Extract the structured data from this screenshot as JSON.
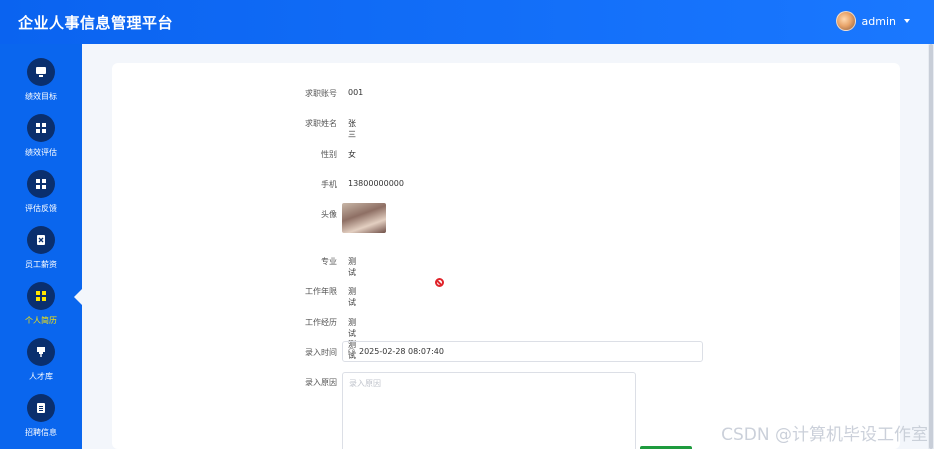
{
  "app": {
    "title": "企业人事信息管理平台"
  },
  "user": {
    "name": "admin"
  },
  "sidebar": {
    "items": [
      {
        "label": "绩效目标",
        "icon": "monitor-icon",
        "active": false
      },
      {
        "label": "绩效评估",
        "icon": "grid-icon",
        "active": false
      },
      {
        "label": "评估反馈",
        "icon": "grid-icon",
        "active": false
      },
      {
        "label": "员工薪资",
        "icon": "clipboard-x-icon",
        "active": false
      },
      {
        "label": "个人简历",
        "icon": "grid-icon",
        "active": true
      },
      {
        "label": "人才库",
        "icon": "pin-icon",
        "active": false
      },
      {
        "label": "招聘信息",
        "icon": "clipboard-icon",
        "active": false
      }
    ]
  },
  "form": {
    "job_id": {
      "label": "求职账号",
      "value": "001"
    },
    "name": {
      "label": "求职姓名",
      "value": "张三"
    },
    "gender": {
      "label": "性别",
      "value": "女"
    },
    "phone": {
      "label": "手机",
      "value": "13800000000"
    },
    "avatar": {
      "label": "头像"
    },
    "major": {
      "label": "专业",
      "value": "测试"
    },
    "work_years": {
      "label": "工作年限",
      "value": "测试"
    },
    "experience": {
      "label": "工作经历",
      "value": "测试测试"
    },
    "entry_time": {
      "label": "录入时间",
      "value": "2025-02-28 08:07:40"
    },
    "entry_reason": {
      "label": "录入原因",
      "placeholder": "录入原因"
    }
  },
  "watermark": "CSDN @计算机毕设工作室",
  "colors": {
    "header": "#0a63f0",
    "sidebar": "#0a66ee",
    "active_label": "#ffe600",
    "icon_circle": "#0a2f6e"
  }
}
